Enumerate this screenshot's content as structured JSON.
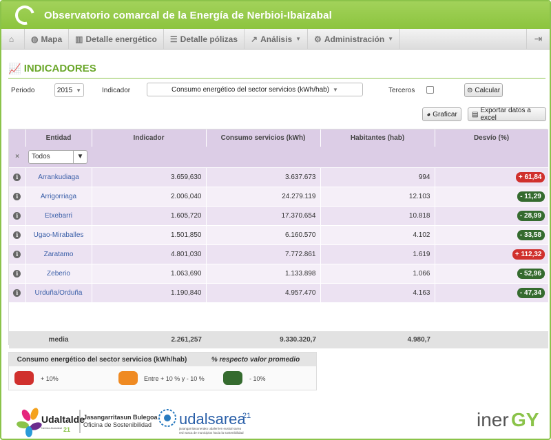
{
  "app": {
    "title": "Observatorio comarcal de la Energía de Nerbioi-Ibaizabal"
  },
  "nav": {
    "items": [
      {
        "label": "Mapa",
        "icon": "globe-icon"
      },
      {
        "label": "Detalle energético",
        "icon": "bar-chart-icon"
      },
      {
        "label": "Detalle pólizas",
        "icon": "list-icon"
      },
      {
        "label": "Análisis",
        "icon": "line-chart-icon"
      },
      {
        "label": "Administración",
        "icon": "cogs-icon"
      }
    ]
  },
  "section": {
    "title": "INDICADORES"
  },
  "controls": {
    "periodo_label": "Periodo",
    "periodo_value": "2015",
    "indicador_label": "Indicador",
    "indicador_value": "Consumo energético del sector servicios (kWh/hab)",
    "terceros_label": "Terceros",
    "calcular_label": "Calcular",
    "graficar_label": "Graficar",
    "exportar_label": "Exportar datos a excel"
  },
  "table": {
    "columns": [
      "Entidad",
      "Indicador",
      "Consumo servicios (kWh)",
      "Habitantes (hab)",
      "Desvío (%)"
    ],
    "filter_value": "Todos",
    "rows": [
      {
        "entidad": "Arrankudiaga",
        "indicador": "3.659,630",
        "consumo": "3.637.673",
        "habitantes": "994",
        "desvio": "+ 61,84",
        "sign": "pos"
      },
      {
        "entidad": "Arrigorriaga",
        "indicador": "2.006,040",
        "consumo": "24.279.119",
        "habitantes": "12.103",
        "desvio": "- 11,29",
        "sign": "neg"
      },
      {
        "entidad": "Etxebarri",
        "indicador": "1.605,720",
        "consumo": "17.370.654",
        "habitantes": "10.818",
        "desvio": "- 28,99",
        "sign": "neg"
      },
      {
        "entidad": "Ugao-Miraballes",
        "indicador": "1.501,850",
        "consumo": "6.160.570",
        "habitantes": "4.102",
        "desvio": "- 33,58",
        "sign": "neg"
      },
      {
        "entidad": "Zaratamo",
        "indicador": "4.801,030",
        "consumo": "7.772.861",
        "habitantes": "1.619",
        "desvio": "+ 112,32",
        "sign": "pos"
      },
      {
        "entidad": "Zeberio",
        "indicador": "1.063,690",
        "consumo": "1.133.898",
        "habitantes": "1.066",
        "desvio": "- 52,96",
        "sign": "neg"
      },
      {
        "entidad": "Urduña/Orduña",
        "indicador": "1.190,840",
        "consumo": "4.957.470",
        "habitantes": "4.163",
        "desvio": "- 47,34",
        "sign": "neg"
      }
    ],
    "footer": {
      "label": "media",
      "indicador": "2.261,257",
      "consumo": "9.330.320,7",
      "habitantes": "4.980,7"
    }
  },
  "legend": {
    "title": "Consumo energético del sector servicios (kWh/hab)",
    "subtitle": "% respecto valor promedio",
    "items": [
      {
        "label": "+ 10%",
        "color": "#d0302d"
      },
      {
        "label": "Entre + 10 % y - 10 %",
        "color": "#ef8a22"
      },
      {
        "label": "- 10%",
        "color": "#356b2f"
      }
    ]
  },
  "logos": {
    "udaltalde": "Udaltalde",
    "udaltalde_sub": "Nerbioi-Ibaizabal",
    "udaltalde_num": "21",
    "bulegoa_1": "Jasangarritasun Bulegoa",
    "bulegoa_2": "Oficina de Sostenibilidad",
    "udalsarea": "udalsarea",
    "udalsarea_num": "21",
    "udalsarea_sub1": "jasangarritasunerako udalerrien euskal sarea",
    "udalsarea_sub2": "red vasca de municipios hacia la sostenibilidad",
    "inergy_a": "iner",
    "inergy_b": "GY"
  },
  "colors": {
    "brand_green": "#8cc43e",
    "positive": "#d0302d",
    "negative": "#356b2f",
    "header_purple": "#dccde6"
  }
}
